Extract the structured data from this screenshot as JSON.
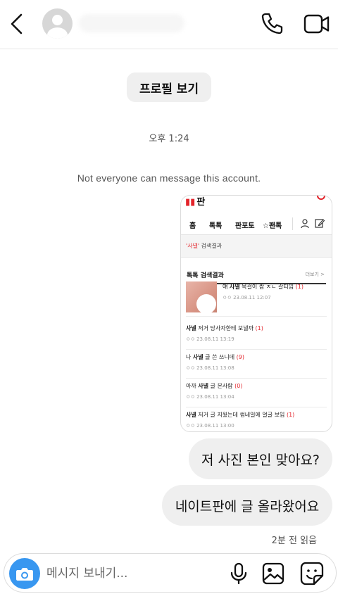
{
  "header": {
    "back_icon": "chevron-left-icon",
    "call_icon": "phone-icon",
    "video_icon": "video-camera-icon"
  },
  "thread": {
    "profile_button": "프로필 보기",
    "timestamp": "오후 1:24",
    "notice": "Not everyone can message this account.",
    "shared_image": {
      "logo": "판",
      "nav": [
        "홈",
        "톡톡",
        "판포토",
        "☆팬톡"
      ],
      "search_result_term": "'사넬'",
      "search_result_suffix": " 검색결과",
      "section_title": "톡톡 검색결과",
      "section_more": "더보기 >",
      "posts": [
        {
          "pre": "얘 ",
          "bold": "사넬",
          "post": " 목걸이 짭 ㅈㄴ 갈티임",
          "count": "(1)",
          "meta": "ㅇㅇ   23.08.11 12:07"
        },
        {
          "pre": "",
          "bold": "사넬",
          "post": " 저거 당사자한테 보낼까",
          "count": "(1)",
          "meta": "ㅇㅇ   23.08.11 13:19"
        },
        {
          "pre": "나 ",
          "bold": "사넬",
          "post": " 글 쓴 쓰니데",
          "count": "(9)",
          "meta": "ㅇㅇ   23.08.11 13:08"
        },
        {
          "pre": "아까 ",
          "bold": "사넬",
          "post": " 글 본사람",
          "count": "(0)",
          "meta": "ㅇㅇ   23.08.11 13:04"
        },
        {
          "pre": "",
          "bold": "사넬",
          "post": " 저거 글 지웠는데 썸네일에 얼굴 보임",
          "count": "(1)",
          "meta": "ㅇㅇ   23.08.11 13:00"
        }
      ]
    },
    "messages": [
      "저 사진 본인 맞아요?",
      "네이트판에 글 올라왔어요"
    ],
    "read_receipt": "2분 전 읽음"
  },
  "composer": {
    "placeholder": "메시지 보내기...",
    "camera_icon": "camera-icon",
    "mic_icon": "microphone-icon",
    "gallery_icon": "image-icon",
    "sticker_icon": "sticker-icon",
    "accent": "#3897f0"
  }
}
